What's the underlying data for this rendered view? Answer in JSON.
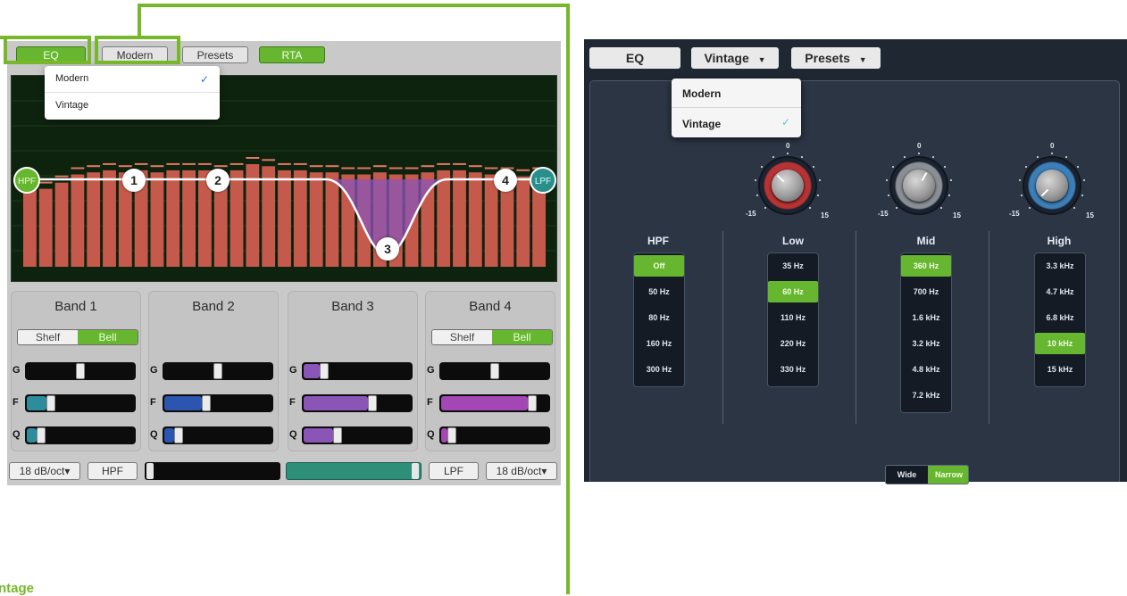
{
  "modern_eq": {
    "toolbar": {
      "eq": "EQ",
      "type": "Modern",
      "presets": "Presets",
      "rta": "RTA"
    },
    "type_menu": {
      "items": [
        "Modern",
        "Vintage"
      ],
      "selected": "Modern",
      "check": "✓"
    },
    "graph": {
      "nodes": [
        "1",
        "2",
        "3",
        "4"
      ],
      "hpf": "HPF",
      "lpf": "LPF",
      "rta_levels": [
        0.41,
        0.38,
        0.41,
        0.45,
        0.46,
        0.47,
        0.46,
        0.47,
        0.46,
        0.47,
        0.47,
        0.47,
        0.46,
        0.47,
        0.5,
        0.49,
        0.47,
        0.47,
        0.46,
        0.46,
        0.45,
        0.45,
        0.46,
        0.45,
        0.45,
        0.46,
        0.47,
        0.47,
        0.46,
        0.45,
        0.45,
        0.44,
        0.45
      ]
    },
    "bands": [
      {
        "title": "Band 1",
        "shelf": "Shelf",
        "bell": "Bell",
        "g": "G",
        "f": "F",
        "q": "Q",
        "gain": 0.5,
        "freq": 0.2,
        "q_val": 0.1
      },
      {
        "title": "Band 2",
        "shelf": "",
        "bell": "",
        "g": "G",
        "f": "F",
        "q": "Q",
        "gain": 0.5,
        "freq": 0.38,
        "q_val": 0.1
      },
      {
        "title": "Band 3",
        "shelf": "",
        "bell": "",
        "g": "G",
        "f": "F",
        "q": "Q",
        "gain": 0.16,
        "freq": 0.65,
        "q_val": 0.3
      },
      {
        "title": "Band 4",
        "shelf": "Shelf",
        "bell": "Bell",
        "g": "G",
        "f": "F",
        "q": "Q",
        "gain": 0.5,
        "freq": 0.88,
        "q_val": 0.06
      }
    ],
    "bottom": {
      "hpf_slope": "18 dB/oct▾",
      "hpf": "HPF",
      "lpf": "LPF",
      "lpf_slope": "18 dB/oct▾"
    },
    "colors": {
      "green": "#67b630",
      "bar": "#c55a4c",
      "band1": "#2e8d9c",
      "band2": "#2c55b0",
      "band3": "#8b55b8",
      "band4": "#a347b5"
    }
  },
  "vintage_eq": {
    "toolbar": {
      "eq": "EQ",
      "type": "Vintage",
      "presets": "Presets"
    },
    "type_menu": {
      "items": [
        "Modern",
        "Vintage"
      ],
      "selected": "Vintage",
      "check": "✓"
    },
    "knobs": [
      {
        "zero": "0",
        "min": "-15",
        "max": "15",
        "color": "#b83333"
      },
      {
        "zero": "0",
        "min": "-15",
        "max": "15",
        "color": "#8a8f96"
      },
      {
        "zero": "0",
        "min": "-15",
        "max": "15",
        "color": "#3c7fb8"
      }
    ],
    "columns": [
      {
        "title": "HPF",
        "options": [
          "Off",
          "50 Hz",
          "80 Hz",
          "160 Hz",
          "300 Hz"
        ],
        "selected": 0
      },
      {
        "title": "Low",
        "options": [
          "35 Hz",
          "60 Hz",
          "110 Hz",
          "220 Hz",
          "330 Hz"
        ],
        "selected": 1
      },
      {
        "title": "Mid",
        "options": [
          "360 Hz",
          "700 Hz",
          "1.6 kHz",
          "3.2 kHz",
          "4.8 kHz",
          "7.2 kHz"
        ],
        "selected": 0
      },
      {
        "title": "High",
        "options": [
          "3.3 kHz",
          "4.7 kHz",
          "6.8 kHz",
          "10 kHz",
          "15 kHz"
        ],
        "selected": 3
      }
    ],
    "q_toggle": {
      "wide": "Wide",
      "narrow": "Narrow",
      "selected": "Narrow"
    }
  },
  "caption_fragment": "ntage"
}
